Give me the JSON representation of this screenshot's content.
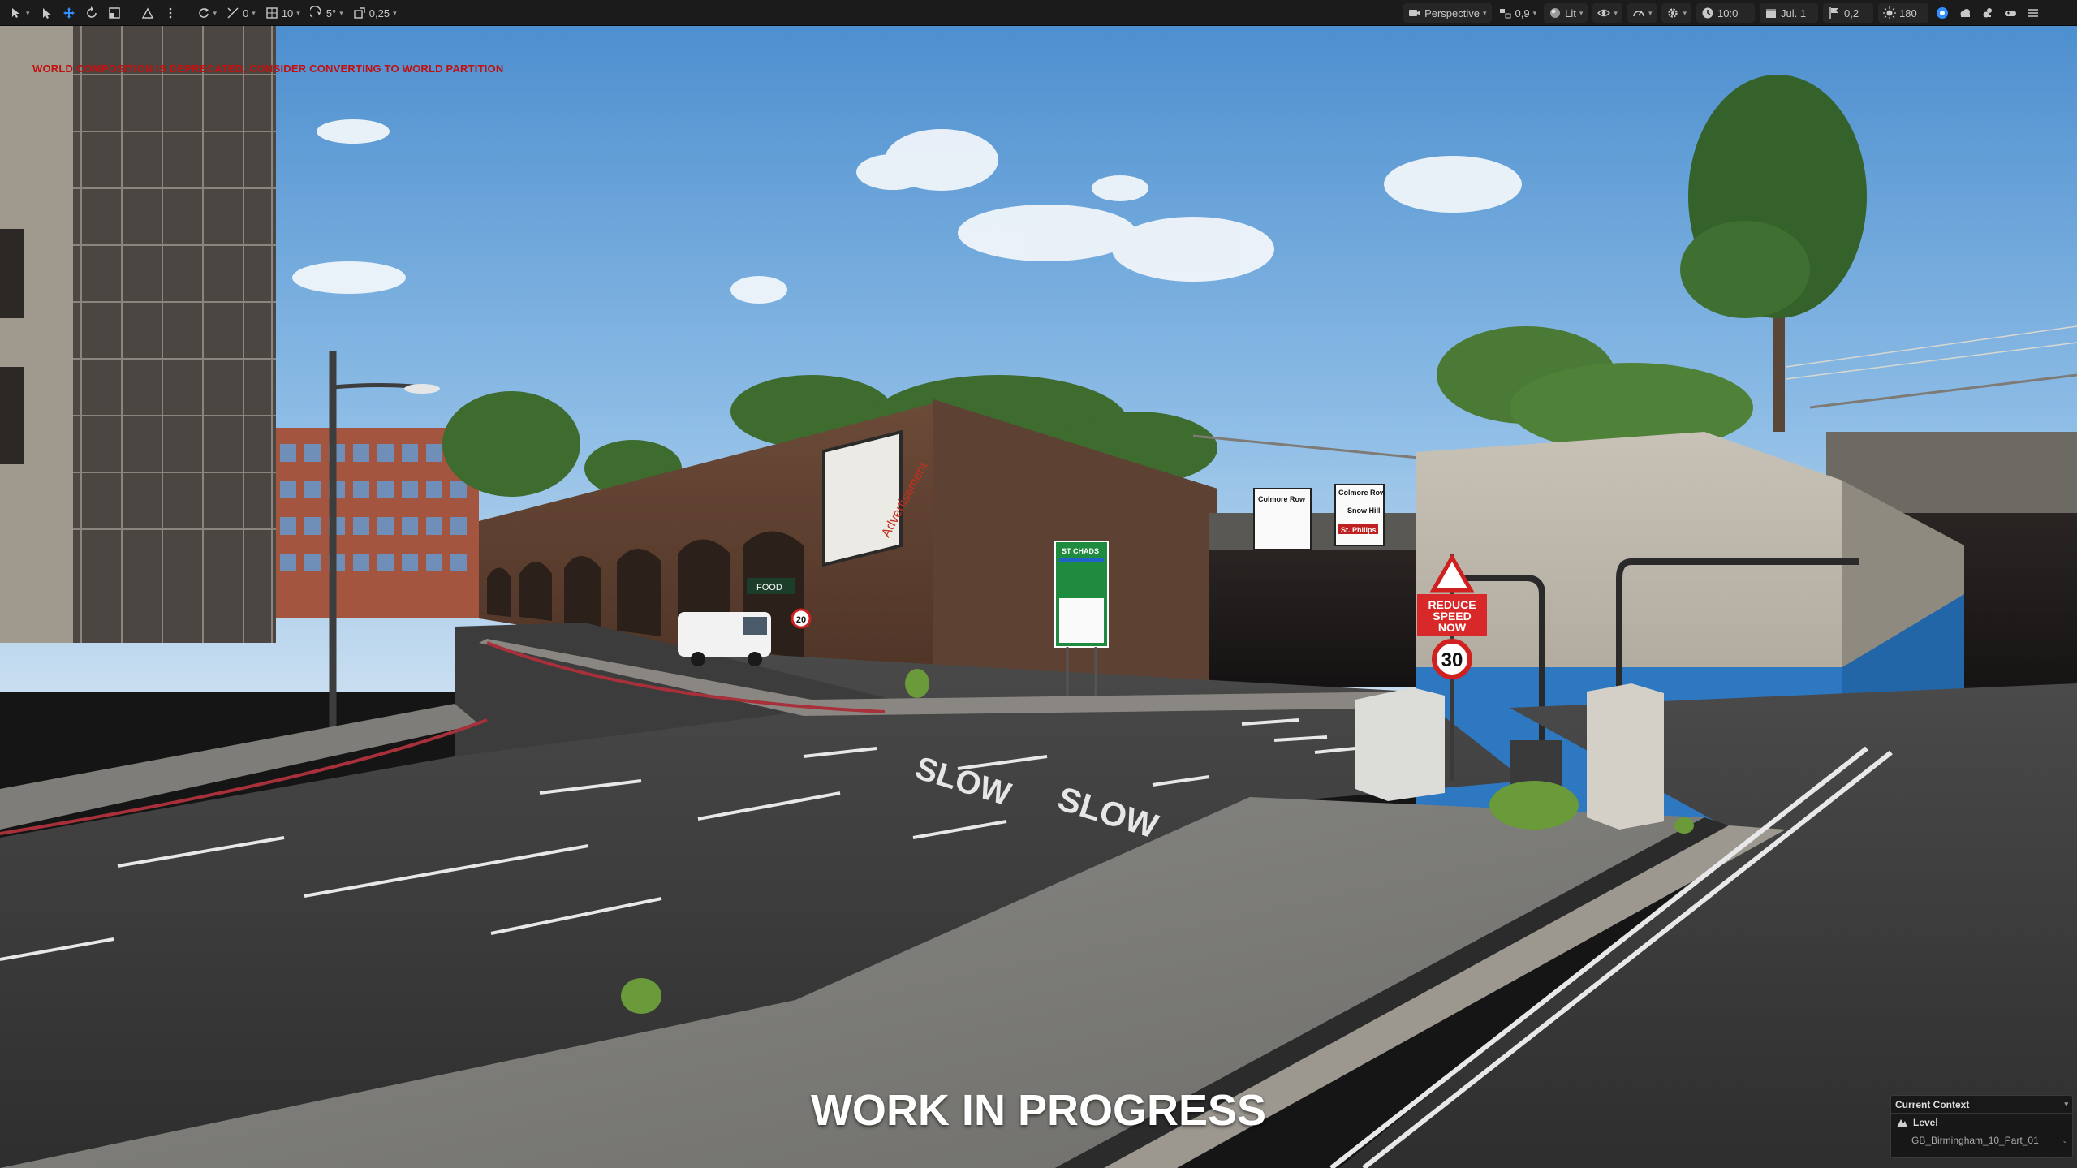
{
  "toolbar": {
    "left": {
      "select_mode_caret": "▾",
      "snap_translate_value": "10",
      "rotate_snap_value": "0",
      "grid_value": "10",
      "angle_snap_value": "5°",
      "scale_snap_value": "0,25"
    },
    "right": {
      "view_mode_label": "Perspective",
      "fov_value": "0,9",
      "lit_label": "Lit",
      "time_value": "10:0",
      "date_value": "Jul. 1",
      "weather_value": "0,2",
      "sun_value": "180"
    }
  },
  "viewport": {
    "warning_text": "WORLD COMPOSITION IS DEPRECATED, CONSIDER CONVERTING TO WORLD PARTITION",
    "overlay_text": "WORK IN PROGRESS"
  },
  "scene_text": {
    "billboard": "Advertisement",
    "road_marking_1": "SLOW",
    "road_marking_2": "SLOW",
    "sign_reduce_1": "REDUCE",
    "sign_reduce_2": "SPEED",
    "sign_reduce_3": "NOW",
    "speed_limit": "30",
    "small_limit": "20",
    "direction_sign_1": "Colmore Row",
    "direction_sign_2": "Colmore Row",
    "direction_sign_3": "Snow Hill",
    "direction_sign_4": "St. Philips",
    "green_sign_title": "ST CHADS",
    "shop_sign": "FOOD"
  },
  "context_panel": {
    "title": "Current Context",
    "level_label": "Level",
    "level_name": "GB_Birmingham_10_Part_01"
  },
  "colors": {
    "toolbar_bg": "#1b1b1b",
    "accent_blue": "#2f8fff",
    "warning_red": "#c01010"
  }
}
